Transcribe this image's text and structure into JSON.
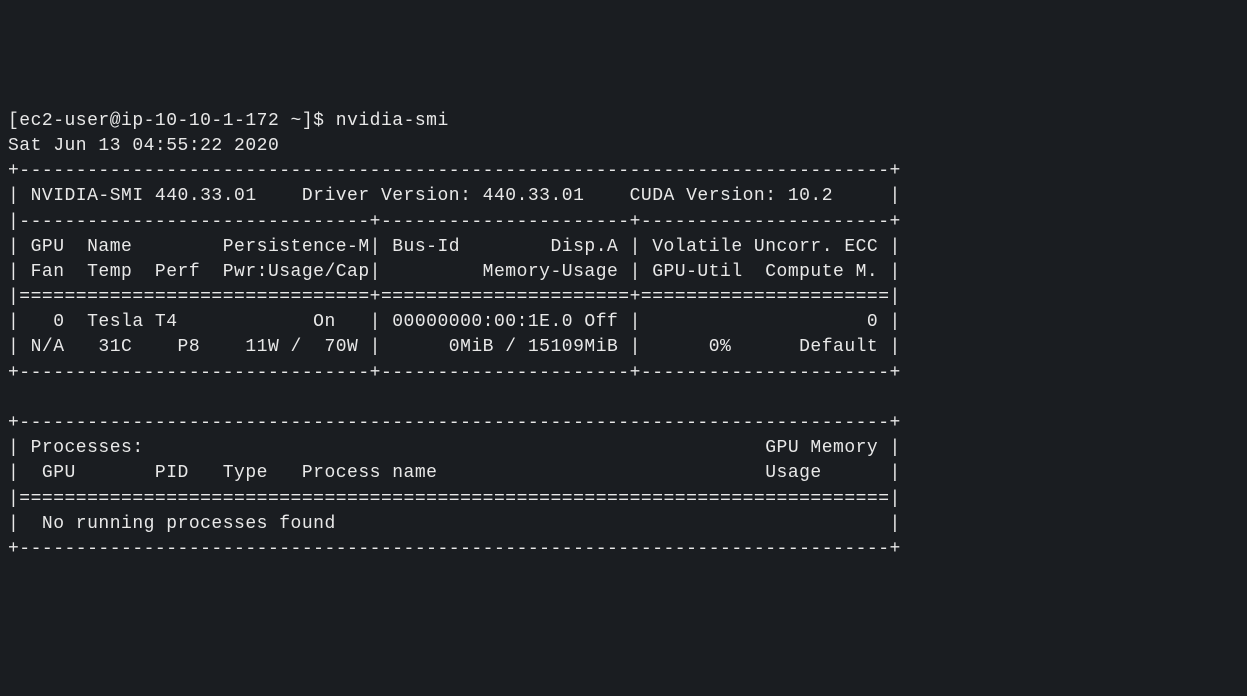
{
  "prompt": "[ec2-user@ip-10-10-1-172 ~]$ ",
  "command": "nvidia-smi",
  "timestamp": "Sat Jun 13 04:55:22 2020",
  "border_top": "+-----------------------------------------------------------------------------+",
  "header_line": "| NVIDIA-SMI 440.33.01    Driver Version: 440.33.01    CUDA Version: 10.2     |",
  "divider1": "|-------------------------------+----------------------+----------------------+",
  "col_header1": "| GPU  Name        Persistence-M| Bus-Id        Disp.A | Volatile Uncorr. ECC |",
  "col_header2": "| Fan  Temp  Perf  Pwr:Usage/Cap|         Memory-Usage | GPU-Util  Compute M. |",
  "divider_eq": "|===============================+======================+======================|",
  "gpu_row1": "|   0  Tesla T4            On   | 00000000:00:1E.0 Off |                    0 |",
  "gpu_row2": "| N/A   31C    P8    11W /  70W |      0MiB / 15109MiB |      0%      Default |",
  "divider_bottom": "+-------------------------------+----------------------+----------------------+",
  "blank": "                                                                               ",
  "proc_top": "+-----------------------------------------------------------------------------+",
  "proc_header": "| Processes:                                                       GPU Memory |",
  "proc_cols": "|  GPU       PID   Type   Process name                             Usage      |",
  "proc_divider": "|=============================================================================|",
  "proc_none": "|  No running processes found                                                 |",
  "proc_bottom": "+-----------------------------------------------------------------------------+",
  "nvidia_smi_version": "440.33.01",
  "driver_version": "440.33.01",
  "cuda_version": "10.2",
  "gpu": {
    "id": "0",
    "name": "Tesla T4",
    "persistence_m": "On",
    "bus_id": "00000000:00:1E.0",
    "disp_a": "Off",
    "volatile_uncorr_ecc": "0",
    "fan": "N/A",
    "temp": "31C",
    "perf": "P8",
    "pwr_usage": "11W",
    "pwr_cap": "70W",
    "memory_used": "0MiB",
    "memory_total": "15109MiB",
    "gpu_util": "0%",
    "compute_m": "Default"
  }
}
